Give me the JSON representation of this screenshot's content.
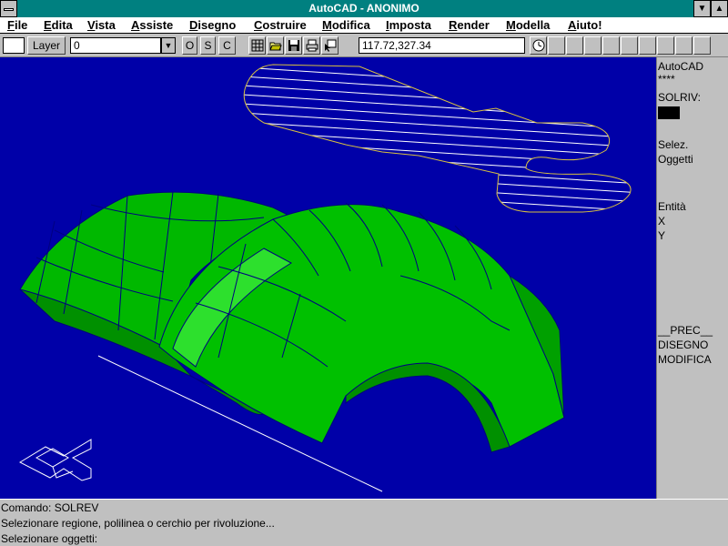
{
  "window": {
    "title": "AutoCAD - ANONIMO",
    "minimize_glyph": "▼",
    "maximize_glyph": "▲"
  },
  "menu": [
    "File",
    "Edita",
    "Vista",
    "Assiste",
    "Disegno",
    "Costruire",
    "Modifica",
    "Imposta",
    "Render",
    "Modella",
    "Aiuto!"
  ],
  "toolbar": {
    "layer_button": "Layer",
    "layer_value": "0",
    "ortho": "O",
    "snap": "S",
    "coords_toggle": "C",
    "coordinates": "117.72,327.34",
    "icons": [
      "tablet-icon",
      "open-file-icon",
      "save-icon",
      "print-icon",
      "select-icon"
    ],
    "spare_button_count": 9
  },
  "side_menu": {
    "header": "AutoCAD",
    "stars": "****",
    "command": "SOLRIV:",
    "swatch_color": "#000000",
    "items": [
      "Selez.",
      "Oggetti",
      "Entità",
      "X",
      "Y",
      "__PREC__",
      "DISEGNO",
      "MODIFICA"
    ]
  },
  "command": {
    "lines": [
      "Comando: SOLREV",
      "Selezionare regione, polilinea o cerchio per rivoluzione...",
      "Selezionare oggetti:"
    ]
  },
  "colors": {
    "title_bar": "#008080",
    "canvas": "#0000a8",
    "solid_fill": "#00c000",
    "highlight": "#2de02d",
    "mesh_lines": "#000080",
    "region_outline": "#d8c040",
    "hatch": "#ffffff"
  }
}
